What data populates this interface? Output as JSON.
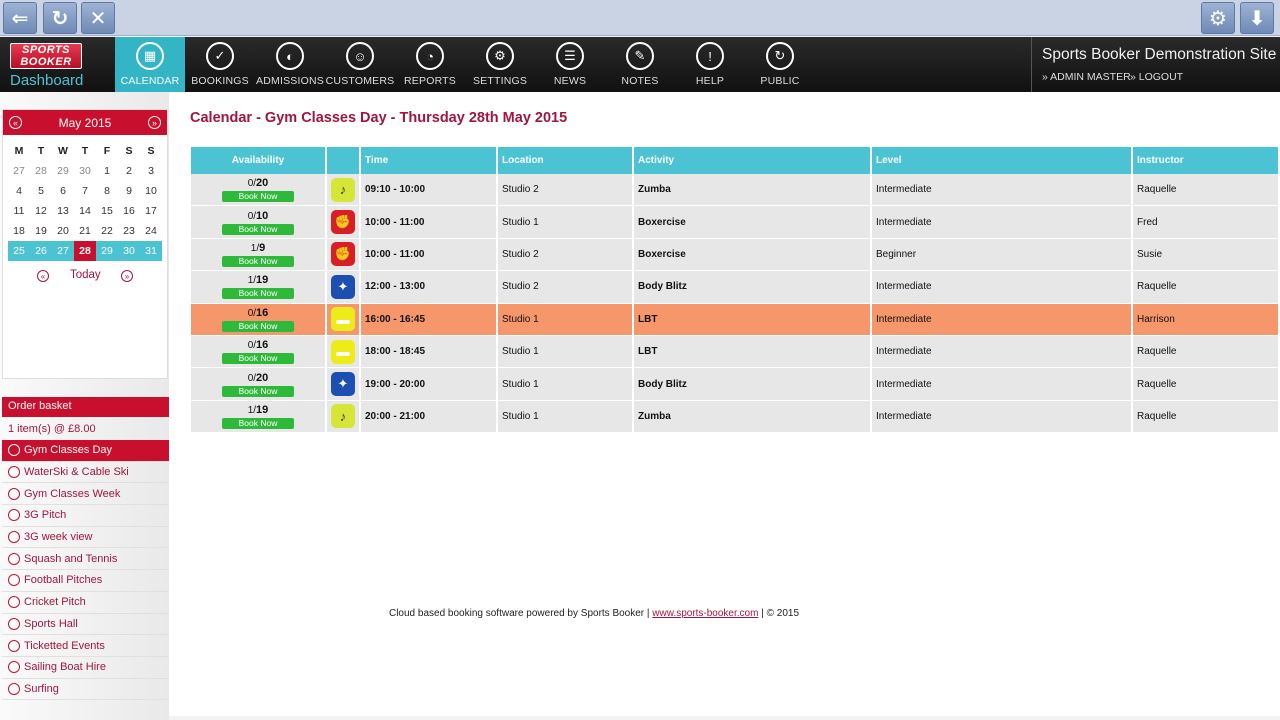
{
  "nav": {
    "logo_line1": "SPORTS",
    "logo_line2": "BOOKER",
    "dashboard": "Dashboard",
    "items": [
      {
        "label": "CALENDAR",
        "icon": "calendar-icon"
      },
      {
        "label": "BOOKINGS",
        "icon": "check-icon"
      },
      {
        "label": "ADMISSIONS",
        "icon": "lungs-icon"
      },
      {
        "label": "CUSTOMERS",
        "icon": "user-icon"
      },
      {
        "label": "REPORTS",
        "icon": "pie-chart-icon"
      },
      {
        "label": "SETTINGS",
        "icon": "gear-icon"
      },
      {
        "label": "NEWS",
        "icon": "news-icon"
      },
      {
        "label": "NOTES",
        "icon": "note-icon"
      },
      {
        "label": "HELP",
        "icon": "exclamation-icon"
      },
      {
        "label": "PUBLIC",
        "icon": "refresh-icon"
      }
    ],
    "site_title": "Sports Booker Demonstration Site",
    "admin_link": "» ADMIN MASTER",
    "logout_link": "» LOGOUT"
  },
  "calendar": {
    "month_label": "May 2015",
    "prev": "«",
    "next": "»",
    "dow": [
      "M",
      "T",
      "W",
      "T",
      "F",
      "S",
      "S"
    ],
    "weeks": [
      [
        "27",
        "28",
        "29",
        "30",
        "1",
        "2",
        "3"
      ],
      [
        "4",
        "5",
        "6",
        "7",
        "8",
        "9",
        "10"
      ],
      [
        "11",
        "12",
        "13",
        "14",
        "15",
        "16",
        "17"
      ],
      [
        "18",
        "19",
        "20",
        "21",
        "22",
        "23",
        "24"
      ],
      [
        "25",
        "26",
        "27",
        "28",
        "29",
        "30",
        "31"
      ]
    ],
    "today_label": "Today"
  },
  "basket": {
    "title": "Order basket",
    "info": "1 item(s) @ £8.00"
  },
  "menu": [
    "Gym Classes Day",
    "WaterSki & Cable Ski",
    "Gym Classes Week",
    "3G Pitch",
    "3G week view",
    "Squash and Tennis",
    "Football Pitches",
    "Cricket Pitch",
    "Sports Hall",
    "Ticketted Events",
    "Sailing Boat Hire",
    "Surfing"
  ],
  "main": {
    "title": "Calendar - Gym Classes Day - Thursday 28th May 2015",
    "columns": [
      "Availability",
      "",
      "Time",
      "Location",
      "Activity",
      "Level",
      "Instructor"
    ],
    "book_label": "Book Now",
    "rows": [
      {
        "booked": "0/",
        "cap": "20",
        "icon": "zumba-icon",
        "time": "09:10 - 10:00",
        "location": "Studio 2",
        "activity": "Zumba",
        "level": "Intermediate",
        "instructor": "Raquelle"
      },
      {
        "booked": "0/",
        "cap": "10",
        "icon": "boxercise-icon",
        "time": "10:00 - 11:00",
        "location": "Studio 1",
        "activity": "Boxercise",
        "level": "Intermediate",
        "instructor": "Fred"
      },
      {
        "booked": "1/",
        "cap": "9",
        "icon": "boxercise-icon",
        "time": "10:00 - 11:00",
        "location": "Studio 2",
        "activity": "Boxercise",
        "level": "Beginner",
        "instructor": "Susie"
      },
      {
        "booked": "1/",
        "cap": "19",
        "icon": "body-blitz-icon",
        "time": "12:00 - 13:00",
        "location": "Studio 2",
        "activity": "Body Blitz",
        "level": "Intermediate",
        "instructor": "Raquelle"
      },
      {
        "booked": "0/",
        "cap": "16",
        "icon": "lbt-icon",
        "time": "16:00 - 16:45",
        "location": "Studio 1",
        "activity": "LBT",
        "level": "Intermediate",
        "instructor": "Harrison"
      },
      {
        "booked": "0/",
        "cap": "16",
        "icon": "lbt-icon",
        "time": "18:00 - 18:45",
        "location": "Studio 1",
        "activity": "LBT",
        "level": "Intermediate",
        "instructor": "Raquelle"
      },
      {
        "booked": "0/",
        "cap": "20",
        "icon": "body-blitz-icon",
        "time": "19:00 - 20:00",
        "location": "Studio 1",
        "activity": "Body Blitz",
        "level": "Intermediate",
        "instructor": "Raquelle"
      },
      {
        "booked": "1/",
        "cap": "19",
        "icon": "zumba-icon",
        "time": "20:00 - 21:00",
        "location": "Studio 1",
        "activity": "Zumba",
        "level": "Intermediate",
        "instructor": "Raquelle"
      }
    ]
  },
  "footer": {
    "text_before": "Cloud based booking software powered by Sports Booker |",
    "link": "www.sports-booker.com",
    "text_after": "| © 2015"
  },
  "colors": {
    "brand_red": "#c8102e",
    "accent_teal": "#4cc3d2",
    "highlight_orange": "#f6966b",
    "book_green": "#2fb93a"
  }
}
